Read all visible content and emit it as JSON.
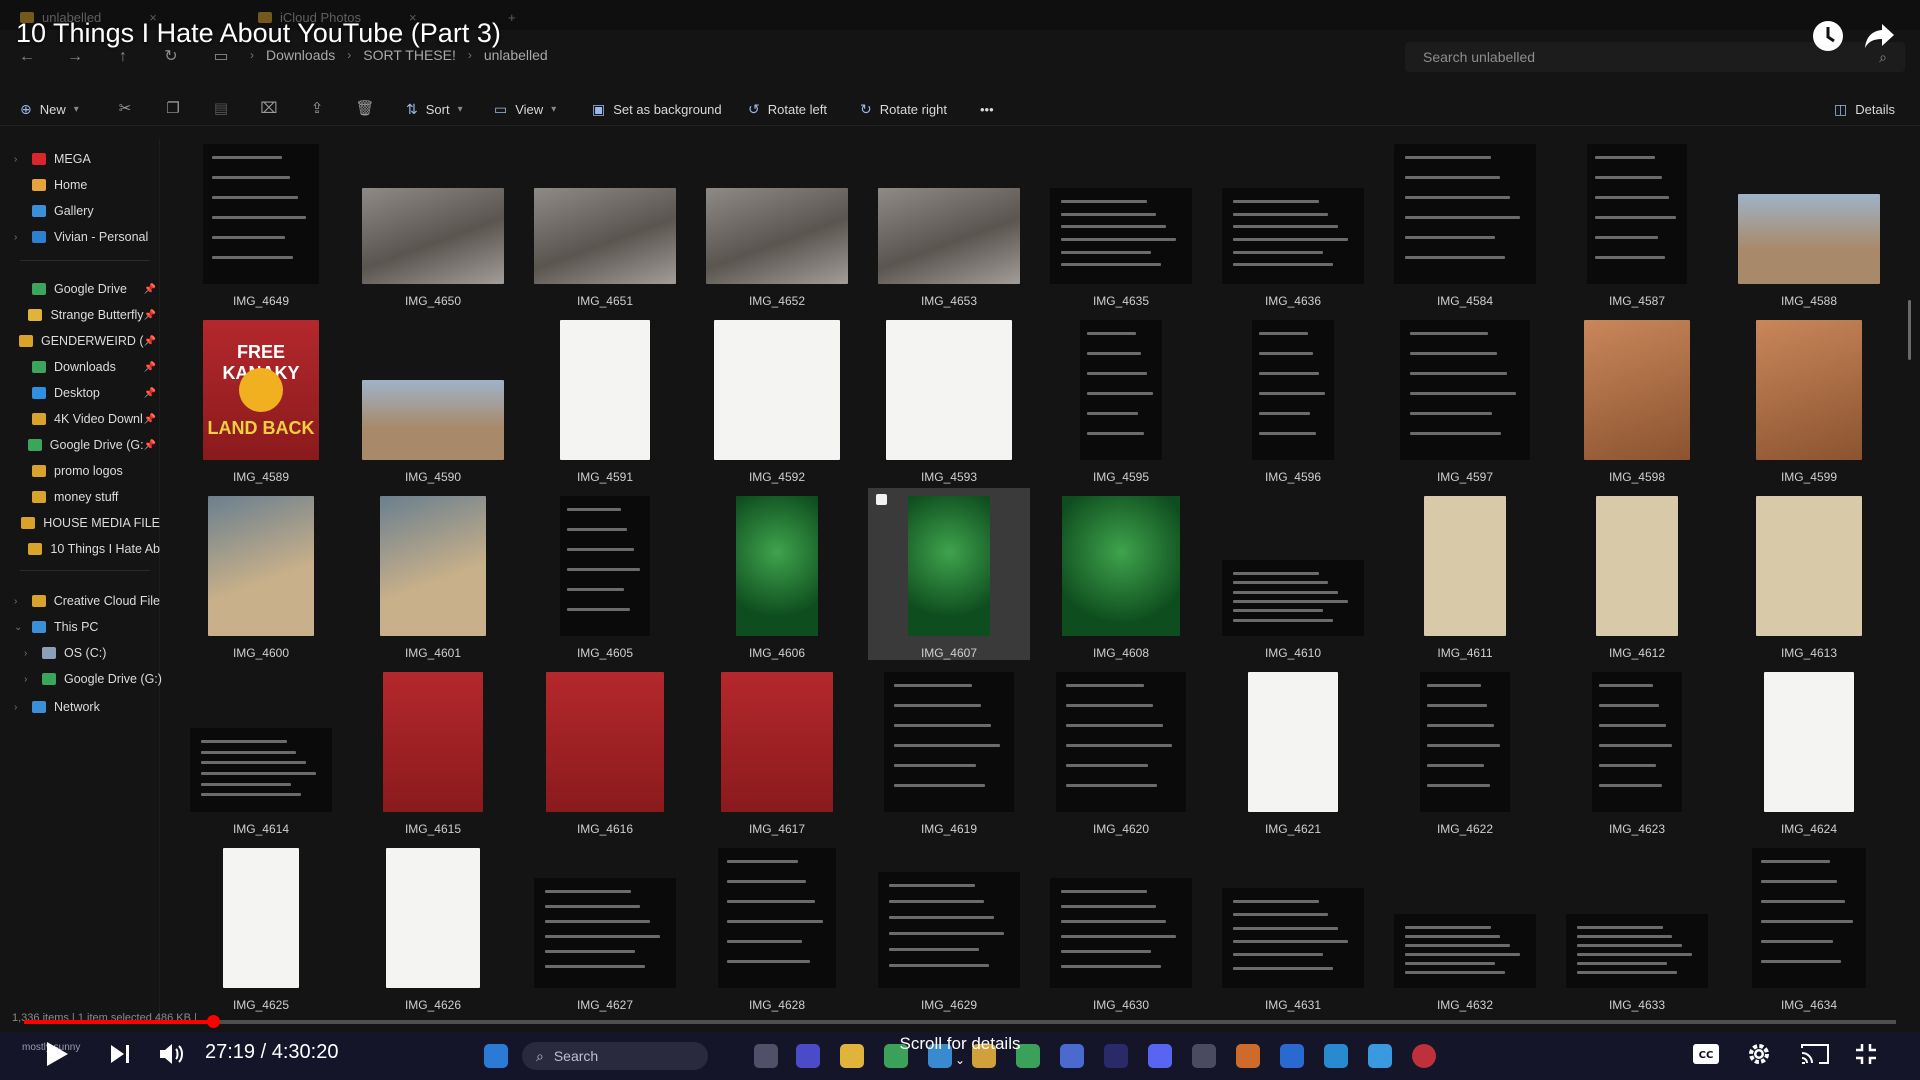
{
  "video": {
    "title": "10 Things I Hate About YouTube (Part 3)",
    "current_time": "27:19",
    "separator": " / ",
    "duration": "4:30:20",
    "progress_fraction": 0.101,
    "scroll_hint": "Scroll for details"
  },
  "explorer": {
    "tabs": [
      {
        "label": "unlabelled"
      },
      {
        "label": "iCloud Photos"
      }
    ],
    "breadcrumbs": [
      "Downloads",
      "SORT THESE!",
      "unlabelled"
    ],
    "search_placeholder": "Search unlabelled",
    "commands": {
      "new": "New",
      "sort": "Sort",
      "view": "View",
      "set_background": "Set as background",
      "rotate_left": "Rotate left",
      "rotate_right": "Rotate right",
      "more": "•••",
      "details": "Details"
    },
    "status": "1,336 items  |  1 item selected  486 KB  |",
    "sidebar": [
      {
        "label": "MEGA",
        "color": "#d9262c",
        "chev": true
      },
      {
        "label": "Home",
        "color": "#e6a23c"
      },
      {
        "label": "Gallery",
        "color": "#3b8fd6"
      },
      {
        "label": "Vivian - Personal",
        "color": "#2f7fd1",
        "chev": true
      },
      {
        "label": "Google Drive",
        "color": "#3ba55c",
        "pin": true
      },
      {
        "label": "Strange Butterfly",
        "color": "#e0b43a",
        "pin": true
      },
      {
        "label": "GENDERWEIRD (",
        "color": "#d9a22a",
        "pin": true
      },
      {
        "label": "Downloads",
        "color": "#3ba55c",
        "pin": true
      },
      {
        "label": "Desktop",
        "color": "#2f8fe0",
        "pin": true
      },
      {
        "label": "4K Video Downl",
        "color": "#d9a22a",
        "pin": true
      },
      {
        "label": "Google Drive (G:",
        "color": "#3ba55c",
        "pin": true
      },
      {
        "label": "promo logos",
        "color": "#d9a22a"
      },
      {
        "label": "money stuff",
        "color": "#d9a22a"
      },
      {
        "label": "HOUSE MEDIA FILE",
        "color": "#d9a22a"
      },
      {
        "label": "10 Things I Hate Ab",
        "color": "#d9a22a"
      },
      {
        "label": "Creative Cloud File",
        "color": "#d9a22a",
        "chev": true
      },
      {
        "label": "This PC",
        "color": "#3b8fd6",
        "chev": true,
        "open": true
      },
      {
        "label": "OS (C:)",
        "color": "#8aa0b8",
        "chev": true,
        "indent": true
      },
      {
        "label": "Google Drive (G:)",
        "color": "#3ba55c",
        "chev": true,
        "indent": true
      },
      {
        "label": "Network",
        "color": "#3b8fd6",
        "chev": true
      }
    ],
    "files": [
      [
        "IMG_4649",
        "IMG_4650",
        "IMG_4651",
        "IMG_4652",
        "IMG_4653",
        "IMG_4635",
        "IMG_4636",
        "IMG_4584",
        "IMG_4587",
        "IMG_4588"
      ],
      [
        "IMG_4589",
        "IMG_4590",
        "IMG_4591",
        "IMG_4592",
        "IMG_4593",
        "IMG_4595",
        "IMG_4596",
        "IMG_4597",
        "IMG_4598",
        "IMG_4599"
      ],
      [
        "IMG_4600",
        "IMG_4601",
        "IMG_4605",
        "IMG_4606",
        "IMG_4607",
        "IMG_4608",
        "IMG_4610",
        "IMG_4611",
        "IMG_4612",
        "IMG_4613"
      ],
      [
        "IMG_4614",
        "IMG_4615",
        "IMG_4616",
        "IMG_4617",
        "IMG_4619",
        "IMG_4620",
        "IMG_4621",
        "IMG_4622",
        "IMG_4623",
        "IMG_4624"
      ],
      [
        "IMG_4625",
        "IMG_4626",
        "IMG_4627",
        "IMG_4628",
        "IMG_4629",
        "IMG_4630",
        "IMG_4631",
        "IMG_4632",
        "IMG_4633",
        "IMG_4634"
      ]
    ],
    "selected_file": "IMG_4607",
    "thumb_text": {
      "free_kanaky": "FREE KANAKY",
      "land_back": "LAND BACK"
    }
  },
  "taskbar": {
    "search": "Search",
    "weather": "mostly sunny"
  }
}
